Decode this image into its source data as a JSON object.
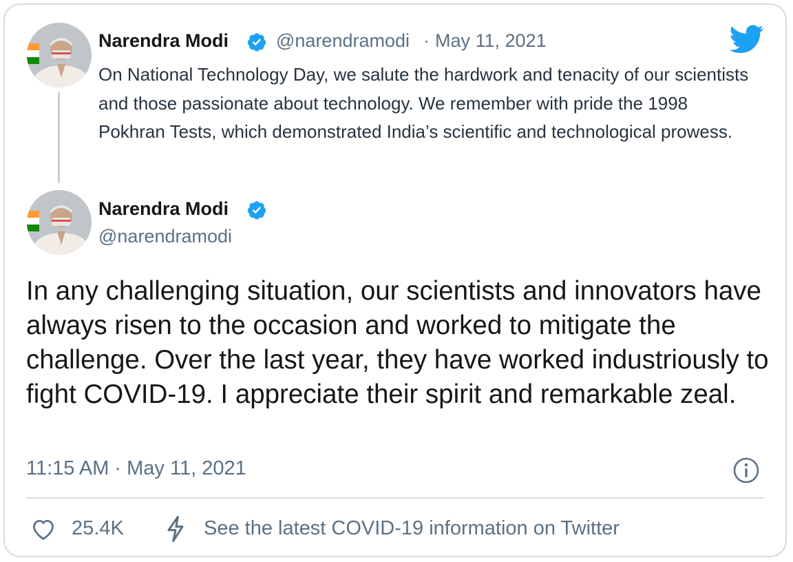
{
  "quoted_tweet": {
    "author_name": "Narendra Modi",
    "author_handle": "@narendramodi",
    "separator": "·",
    "date": "May 11, 2021",
    "text": "On National Technology Day, we salute the hardwork and tenacity of our scientists and those passionate about technology. We remember with pride the 1998 Pokhran Tests, which demonstrated India’s scientific and technological prowess."
  },
  "tweet": {
    "author_name": "Narendra Modi",
    "author_handle": "@narendramodi",
    "text": "In any challenging situation, our scientists and innovators have always risen to the occasion and worked to mitigate the challenge. Over the last year, they have worked industriously to fight COVID-19. I appreciate their spirit and remarkable zeal.",
    "timestamp": "11:15 AM · May 11, 2021"
  },
  "actions": {
    "like_count": "25.4K",
    "covid_link": "See the latest COVID-19 information on Twitter"
  },
  "icons": {
    "brand": "twitter-bird-icon",
    "verified": "verified-badge-icon",
    "info": "info-icon",
    "like": "heart-icon",
    "covid": "lightning-bolt-icon"
  },
  "colors": {
    "twitter_blue": "#1da1f2",
    "secondary_text": "#5b7083",
    "primary_text": "#14171a"
  }
}
